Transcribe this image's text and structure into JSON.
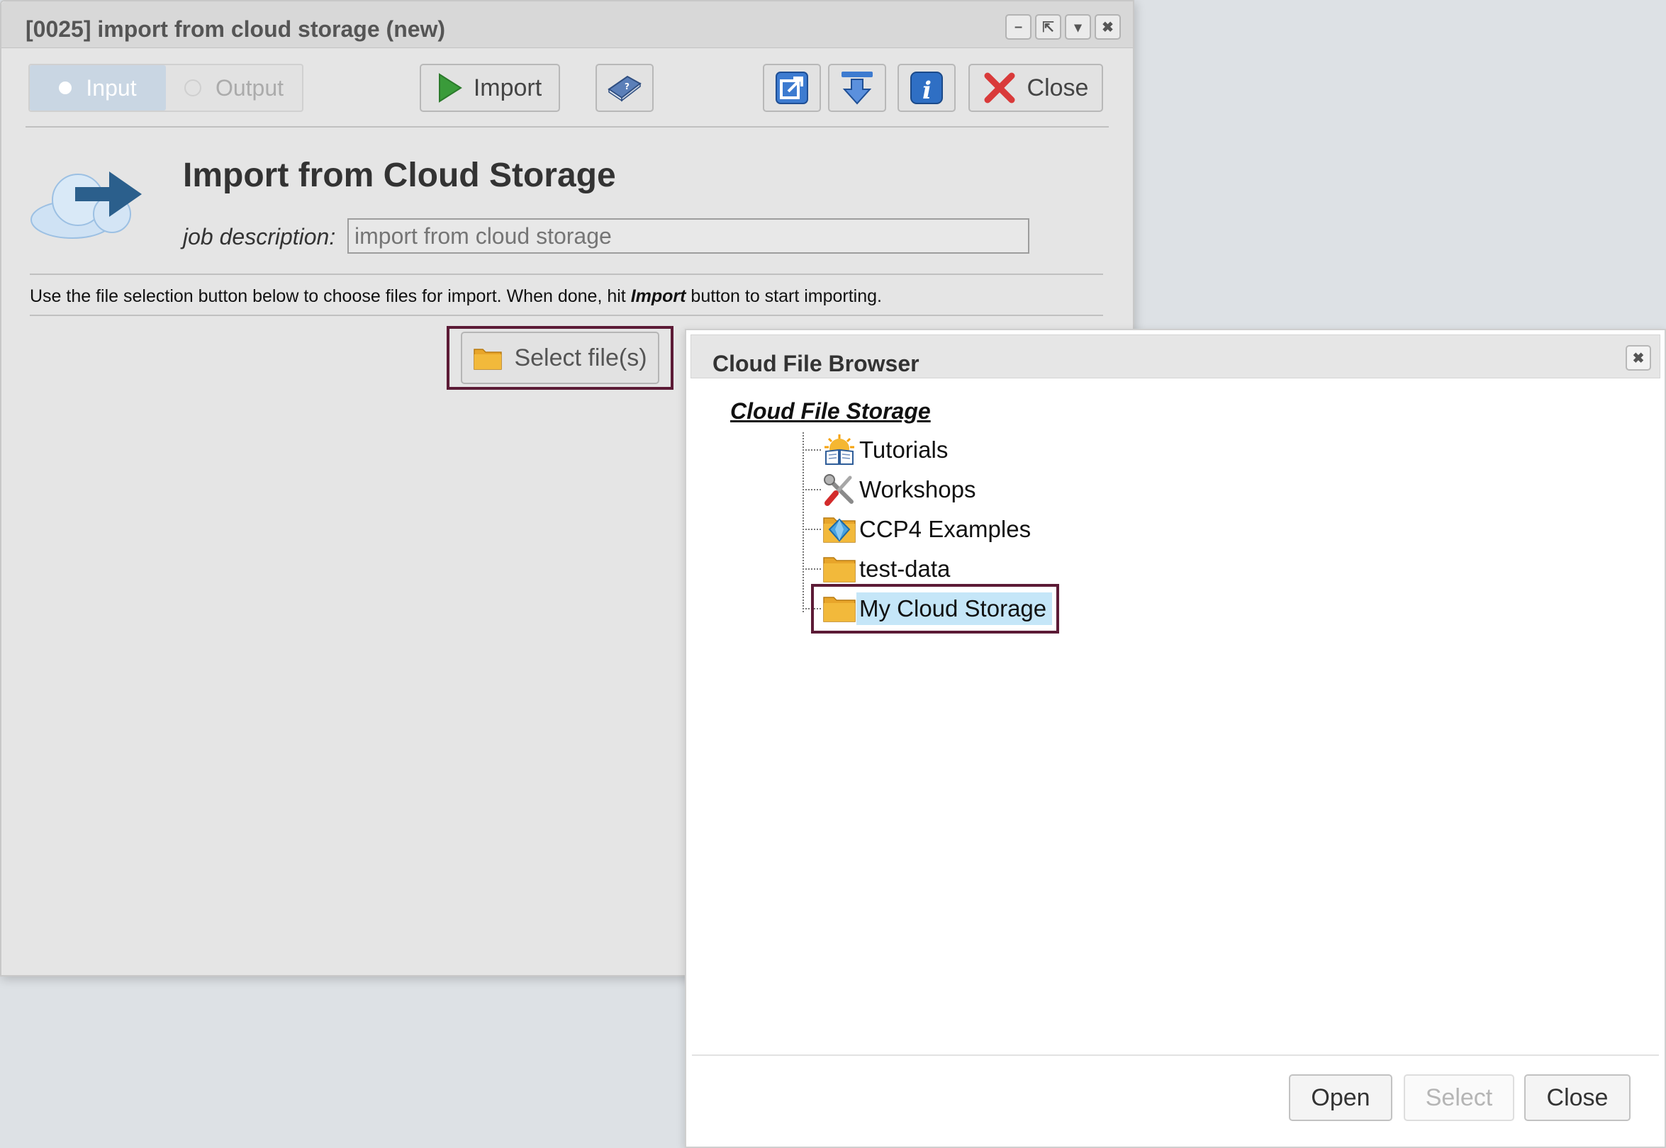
{
  "job_window": {
    "title": "[0025] import from cloud storage (new)",
    "title_buttons": {
      "minimize_glyph": "–",
      "popout_glyph": "⇱",
      "menu_glyph": "▾",
      "close_glyph": "✖"
    },
    "tabs": [
      {
        "label": "Input",
        "selected": true
      },
      {
        "label": "Output",
        "selected": false
      }
    ],
    "toolbar": {
      "import_label": "Import",
      "close_label": "Close",
      "icons": [
        "play-icon",
        "help-book-icon",
        "popout-icon",
        "download-icon",
        "info-icon",
        "close-x-icon"
      ]
    },
    "heading": "Import from Cloud Storage",
    "job_description_label": "job description:",
    "job_description_placeholder": "import from cloud storage",
    "instructions": {
      "before": "Use the file selection button below to choose files for import. When done, hit ",
      "emphasis": "Import",
      "after": " button to start importing."
    },
    "select_files_label": "Select file(s)"
  },
  "browser_dialog": {
    "title": "Cloud File Browser",
    "close_glyph": "✖",
    "root_label": "Cloud File Storage",
    "items": [
      {
        "label": "Tutorials",
        "icon": "book-sun-icon",
        "selected": false
      },
      {
        "label": "Workshops",
        "icon": "tools-icon",
        "selected": false
      },
      {
        "label": "CCP4 Examples",
        "icon": "folder-gem-icon",
        "selected": false
      },
      {
        "label": "test-data",
        "icon": "folder-icon",
        "selected": false
      },
      {
        "label": "My Cloud Storage",
        "icon": "folder-icon",
        "selected": true
      }
    ],
    "buttons": {
      "open_label": "Open",
      "select_label": "Select",
      "close_label": "Close"
    }
  },
  "colors": {
    "highlight_box": "#5c1b36",
    "selected_row": "#c5e6f8",
    "active_tab": "#c9d6e3",
    "play_green": "#3a9b3a",
    "close_red": "#d93a3a",
    "accent_blue": "#2f6fc4",
    "folder_orange": "#e8a52a"
  }
}
